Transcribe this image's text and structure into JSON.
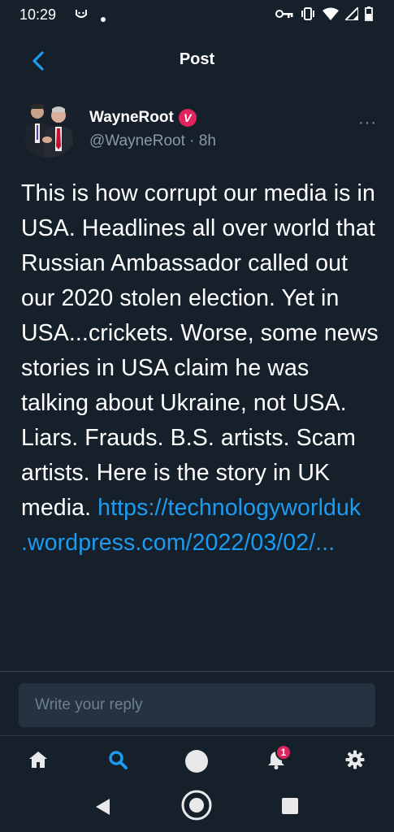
{
  "status_bar": {
    "time": "10:29"
  },
  "header": {
    "title": "Post"
  },
  "tweet": {
    "author_name": "WayneRoot",
    "verified_glyph": "V",
    "handle": "@WayneRoot",
    "separator": " · ",
    "time_ago": "8h",
    "more": "···",
    "text": "This is how corrupt our media is in USA. Headlines all over world that Russian Ambassador called out our 2020 stolen election. Yet in USA...crickets. Worse, some news stories in USA claim he was talking about Ukraine, not USA. Liars. Frauds. B.S. artists. Scam artists. Here is the story in UK media. ",
    "link": "https://technologyworlduk.wordpress.com/2022/03/02/..."
  },
  "reply": {
    "placeholder": "Write your reply"
  },
  "tabbar": {
    "notifications_count": "1",
    "accent": "#1d9bf0"
  },
  "colors": {
    "background": "#15202b",
    "link": "#1d9bf0",
    "badge": "#e0245e"
  }
}
